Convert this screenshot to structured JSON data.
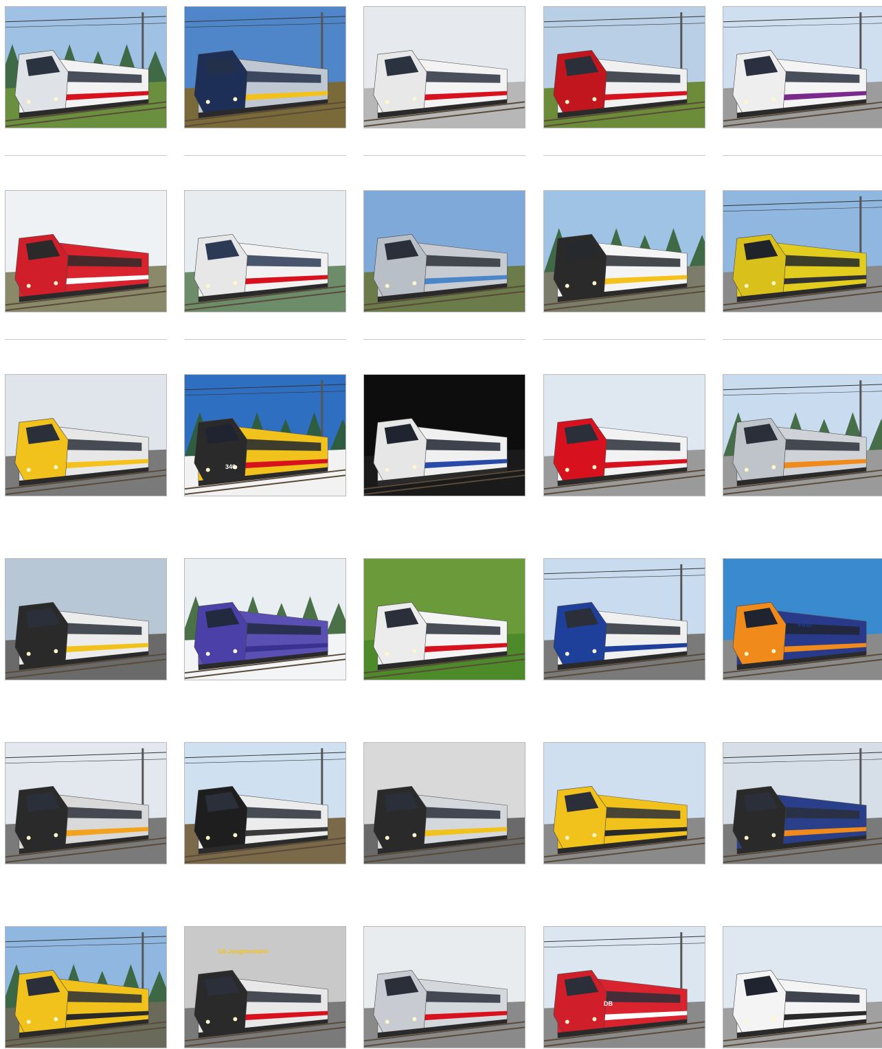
{
  "gallery": {
    "tiles": [
      {
        "row": 0,
        "col": 0,
        "subject": "high-speed train",
        "sky": "#9fc2e4",
        "ground": "#6a8f3e",
        "body": "#f2f2f2",
        "stripe": "#d7121e",
        "nose": "#dfe2e6",
        "window": "#2b3340",
        "trees": true,
        "wires": true
      },
      {
        "row": 0,
        "col": 1,
        "subject": "high-speed train",
        "sky": "#4f86c9",
        "ground": "#7a6a3a",
        "body": "#bfc7d2",
        "stripe": "#f3c21a",
        "nose": "#1e2f57",
        "window": "#22304a",
        "trees": false,
        "wires": true
      },
      {
        "row": 0,
        "col": 2,
        "subject": "high-speed train in station",
        "sky": "#e6eaee",
        "ground": "#b7b7b7",
        "body": "#f3f3f3",
        "stripe": "#d7121e",
        "nose": "#e8e8e8",
        "window": "#2b3340",
        "trees": false,
        "wires": false
      },
      {
        "row": 0,
        "col": 3,
        "subject": "double-deck train",
        "sky": "#b8cfe5",
        "ground": "#6c8c3a",
        "body": "#f0f0f0",
        "stripe": "#d7121e",
        "nose": "#c2161f",
        "window": "#2a2f39",
        "trees": false,
        "wires": true
      },
      {
        "row": 0,
        "col": 4,
        "subject": "high-speed train",
        "sky": "#cfdff0",
        "ground": "#9c9c9c",
        "body": "#f4f4f4",
        "stripe": "#7a2a8c",
        "nose": "#eeeeee",
        "window": "#2a3040",
        "trees": false,
        "wires": true
      },
      {
        "row": 1,
        "col": 0,
        "subject": "regional train",
        "sky": "#eef2f5",
        "ground": "#8a8a6a",
        "body": "#d9232e",
        "stripe": "#ffffff",
        "nose": "#d01f2a",
        "window": "#2a2a2a",
        "trees": false,
        "wires": false
      },
      {
        "row": 1,
        "col": 1,
        "subject": "high-speed train",
        "sky": "#e7ecf1",
        "ground": "#6c8c6a",
        "body": "#f2f2f2",
        "stripe": "#d7121e",
        "nose": "#e7e7e7",
        "window": "#2c3a55",
        "trees": false,
        "wires": false
      },
      {
        "row": 1,
        "col": 2,
        "subject": "metro train",
        "sky": "#7fa9d8",
        "ground": "#6b7b4a",
        "body": "#c8ccd2",
        "stripe": "#4a86c8",
        "nose": "#b9bfc7",
        "window": "#2a2f39",
        "trees": false,
        "wires": false
      },
      {
        "row": 1,
        "col": 3,
        "subject": "regional train",
        "sky": "#9fc3e4",
        "ground": "#7c7c6a",
        "body": "#f4f4f4",
        "stripe": "#f4c21a",
        "nose": "#2a2a2a",
        "window": "#26292e",
        "trees": true,
        "wires": false
      },
      {
        "row": 1,
        "col": 4,
        "subject": "locomotive",
        "sky": "#8fb7e0",
        "ground": "#8a8a8a",
        "body": "#e2cc1e",
        "stripe": "#333333",
        "nose": "#d9c01a",
        "window": "#20242a",
        "trees": false,
        "wires": true
      },
      {
        "row": 2,
        "col": 0,
        "subject": "regional train",
        "sky": "#dfe5ea",
        "ground": "#7a7a7a",
        "body": "#e7e7e7",
        "stripe": "#f4c21a",
        "nose": "#f2c21c",
        "window": "#2a2f39",
        "trees": false,
        "wires": false
      },
      {
        "row": 2,
        "col": 1,
        "subject": "tram",
        "sky": "#2f6fc2",
        "ground": "#f2f2f2",
        "body": "#f2c21c",
        "stripe": "#d7121e",
        "nose": "#2a2a2a",
        "window": "#1f2430",
        "trees": true,
        "wires": true
      },
      {
        "row": 2,
        "col": 2,
        "subject": "high-speed train",
        "sky": "#0d0d0d",
        "ground": "#1a1a1a",
        "body": "#f0f0f0",
        "stripe": "#2a4aa8",
        "nose": "#e6e6e6",
        "window": "#1f2430",
        "trees": false,
        "wires": false
      },
      {
        "row": 2,
        "col": 3,
        "subject": "bus",
        "sky": "#dfe8f1",
        "ground": "#9a9a9a",
        "body": "#f2f2f2",
        "stripe": "#d7121e",
        "nose": "#d7121e",
        "window": "#2a2f39",
        "trees": false,
        "wires": false
      },
      {
        "row": 2,
        "col": 4,
        "subject": "tram",
        "sky": "#c8dbef",
        "ground": "#9a9a9a",
        "body": "#cfd3d8",
        "stripe": "#f08a1a",
        "nose": "#bfc4ca",
        "window": "#2a2f39",
        "trees": true,
        "wires": true
      },
      {
        "row": 3,
        "col": 0,
        "subject": "regional train",
        "sky": "#b7c7d6",
        "ground": "#6a6a6a",
        "body": "#ececec",
        "stripe": "#f2c21c",
        "nose": "#2a2a2a",
        "window": "#2a2f39",
        "trees": false,
        "wires": false
      },
      {
        "row": 3,
        "col": 1,
        "subject": "regional train in snow",
        "sky": "#e9eef3",
        "ground": "#f2f4f6",
        "body": "#5a4fb3",
        "stripe": "#3a3290",
        "nose": "#4a40a8",
        "window": "#222a40",
        "trees": true,
        "wires": false
      },
      {
        "row": 3,
        "col": 2,
        "subject": "high-speed train",
        "sky": "#6a9a3a",
        "ground": "#4d8a2a",
        "body": "#f4f4f4",
        "stripe": "#d7121e",
        "nose": "#ececec",
        "window": "#2a2f39",
        "trees": false,
        "wires": false
      },
      {
        "row": 3,
        "col": 3,
        "subject": "commuter train",
        "sky": "#c9dcef",
        "ground": "#7a7a7a",
        "body": "#f0f0f0",
        "stripe": "#1e3f9a",
        "nose": "#1e3f9a",
        "window": "#2a2f39",
        "trees": false,
        "wires": true
      },
      {
        "row": 3,
        "col": 4,
        "subject": "regional train",
        "sky": "#3a8ad0",
        "ground": "#8a8a8a",
        "body": "#2a3a8a",
        "stripe": "#f08a1a",
        "nose": "#f08a1a",
        "window": "#1f2430",
        "trees": false,
        "wires": false
      },
      {
        "row": 4,
        "col": 0,
        "subject": "commuter train",
        "sky": "#e3e8ee",
        "ground": "#7a7a7a",
        "body": "#d9d9d9",
        "stripe": "#f2a21c",
        "nose": "#2a2a2a",
        "window": "#2a2f39",
        "trees": false,
        "wires": true
      },
      {
        "row": 4,
        "col": 1,
        "subject": "regional train",
        "sky": "#cfe0f0",
        "ground": "#7a6a4a",
        "body": "#ececec",
        "stripe": "#3a3a3a",
        "nose": "#1e1e1e",
        "window": "#2a2f39",
        "trees": false,
        "wires": true
      },
      {
        "row": 4,
        "col": 2,
        "subject": "commuter train in station",
        "sky": "#d9d9d9",
        "ground": "#6a6a6a",
        "body": "#d4d8dc",
        "stripe": "#f2c21c",
        "nose": "#2a2a2a",
        "window": "#2a2f39",
        "trees": false,
        "wires": false
      },
      {
        "row": 4,
        "col": 3,
        "subject": "tram",
        "sky": "#cfdff0",
        "ground": "#8a8a8a",
        "body": "#f2c21c",
        "stripe": "#2a2a2a",
        "nose": "#f2c21c",
        "window": "#2a2f39",
        "trees": false,
        "wires": false
      },
      {
        "row": 4,
        "col": 4,
        "subject": "commuter train",
        "sky": "#d6dfe8",
        "ground": "#7a7a7a",
        "body": "#2a3f8a",
        "stripe": "#f08a1a",
        "nose": "#2a2a2a",
        "window": "#2a2f39",
        "trees": false,
        "wires": true
      },
      {
        "row": 5,
        "col": 0,
        "subject": "metro train",
        "sky": "#8fb7e0",
        "ground": "#6a6a5a",
        "body": "#f2c21c",
        "stripe": "#2a2a2a",
        "nose": "#f2c21c",
        "window": "#2a2f39",
        "trees": true,
        "wires": true
      },
      {
        "row": 5,
        "col": 1,
        "subject": "metro train in depot",
        "sky": "#c9c9c9",
        "ground": "#7a7a7a",
        "body": "#e8e8e8",
        "stripe": "#d7121e",
        "nose": "#2a2a2a",
        "window": "#2a2f39",
        "trees": false,
        "wires": false
      },
      {
        "row": 5,
        "col": 2,
        "subject": "tram",
        "sky": "#e9ecef",
        "ground": "#8a8a8a",
        "body": "#d4d8dc",
        "stripe": "#d7121e",
        "nose": "#c8ccd2",
        "window": "#2a2f39",
        "trees": false,
        "wires": false
      },
      {
        "row": 5,
        "col": 3,
        "subject": "regional train",
        "sky": "#dbe6f1",
        "ground": "#8a8a8a",
        "body": "#d9232e",
        "stripe": "#ffffff",
        "nose": "#d01f2a",
        "window": "#2a2f39",
        "trees": false,
        "wires": true
      },
      {
        "row": 5,
        "col": 4,
        "subject": "bus",
        "sky": "#dfe8f1",
        "ground": "#a0a0a0",
        "body": "#f4f4f4",
        "stripe": "#2a2a2a",
        "nose": "#f4f4f4",
        "window": "#1f2430",
        "trees": false,
        "wires": false
      }
    ],
    "captions": [
      {
        "row": 2,
        "col": 1,
        "text": "340"
      },
      {
        "row": 3,
        "col": 4,
        "text": "First"
      },
      {
        "row": 5,
        "col": 1,
        "text": "U5 Jungfernfahrt"
      },
      {
        "row": 5,
        "col": 3,
        "text": "DB"
      }
    ]
  },
  "colors": {
    "rule": "#c8c8c8",
    "border": "#b9b9b9"
  }
}
